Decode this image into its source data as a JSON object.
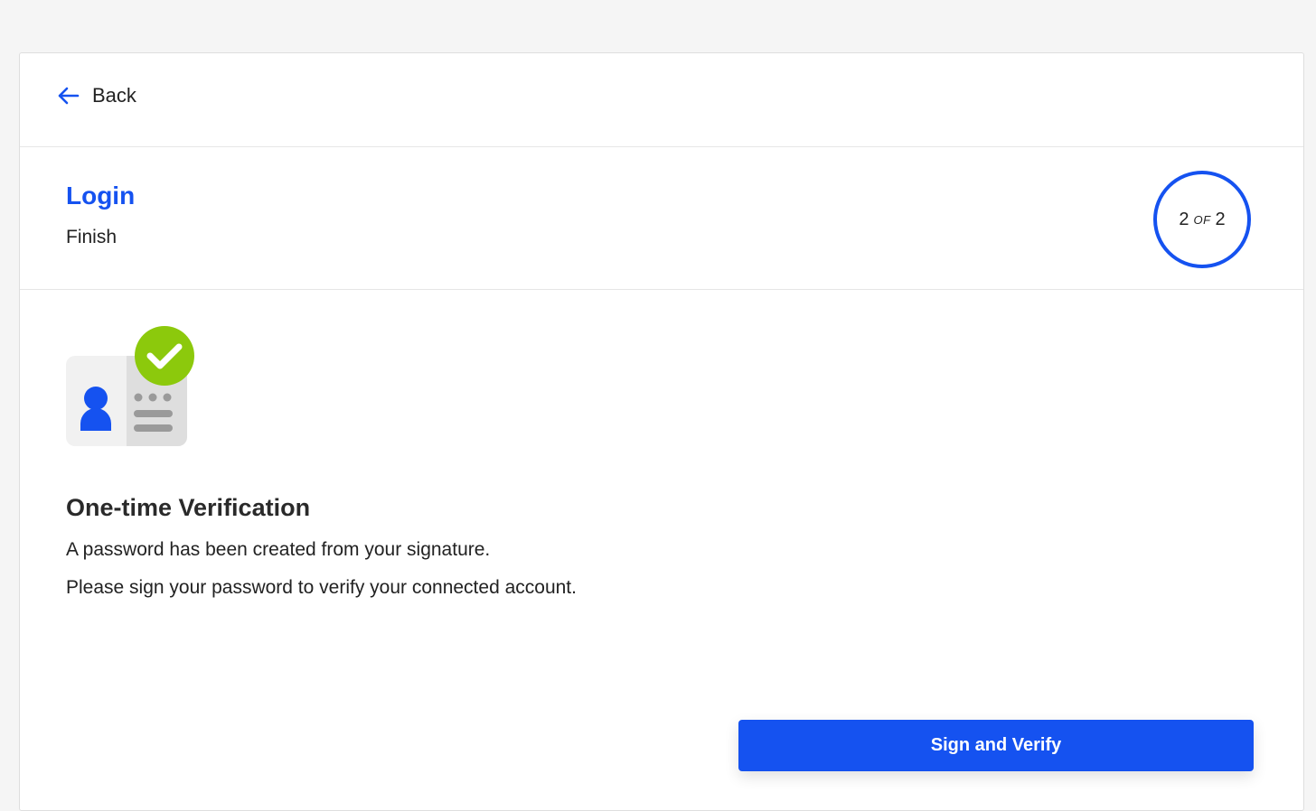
{
  "nav": {
    "back_label": "Back",
    "back_icon": "arrow-left-icon"
  },
  "header": {
    "title": "Login",
    "subtitle": "Finish",
    "step": {
      "current": "2",
      "of_label": "OF",
      "total": "2"
    }
  },
  "main": {
    "illustration_icon": "verified-id-card-icon",
    "title": "One-time Verification",
    "lines": [
      "A password has been created from your signature.",
      "Please sign your password to verify your connected account."
    ],
    "primary_button_label": "Sign and Verify"
  },
  "colors": {
    "accent": "#1552f0",
    "success": "#8cc90c",
    "page_background": "#f5f5f5",
    "card_background": "#ffffff"
  }
}
